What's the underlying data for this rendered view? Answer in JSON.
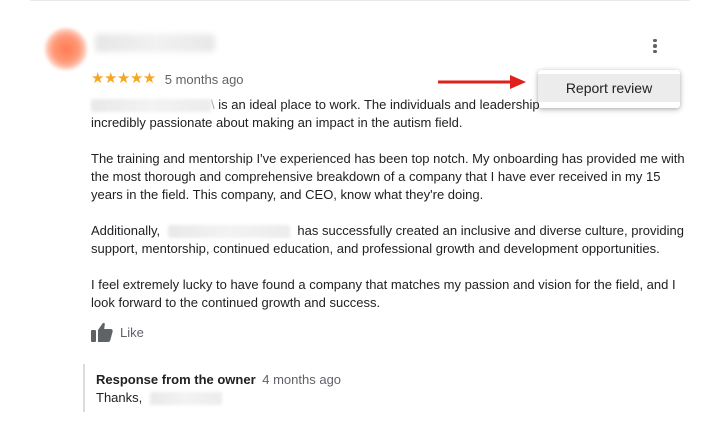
{
  "review": {
    "rating": 5,
    "stars_text": "★★★★★",
    "date": "5 months ago",
    "menu": {
      "report_label": "Report review"
    },
    "paragraphs": {
      "p1_text": "is an ideal place to work. The individuals and leadership",
      "p1_line2": "incredibly passionate about making an impact in the autism field.",
      "p2": "The training and mentorship I've experienced has been top notch. My onboarding has provided me with the most thorough and comprehensive breakdown of a company that I have ever received in my 15 years in the field. This company, and CEO, know what they're doing.",
      "p3_prefix": "Additionally,",
      "p3_suffix": "has successfully created an inclusive and diverse culture, providing support, mentorship, continued education, and professional growth and development opportunities.",
      "p4": "I feel extremely lucky to have found a company that matches my passion and vision for the field, and I look forward to the continued growth and success."
    },
    "like_label": "Like"
  },
  "owner_response": {
    "title": "Response from the owner",
    "date": "4 months ago",
    "text": "Thanks,"
  },
  "colors": {
    "star": "#f5a623",
    "arrow": "#e0201b",
    "muted_text": "#5f6368"
  },
  "icons": {
    "more": "more-vert-icon",
    "like": "thumbs-up-icon",
    "arrow": "arrow-right-icon"
  }
}
